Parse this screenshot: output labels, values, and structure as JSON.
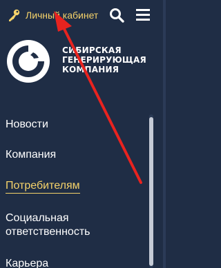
{
  "header": {
    "cabinet_label": "Личный кабинет",
    "key_icon": "key-icon",
    "search_icon": "search-icon",
    "menu_icon": "hamburger-menu-icon"
  },
  "logo": {
    "lines": [
      "СИБИРСКАЯ",
      "ГЕНЕРИРУЮЩАЯ",
      "КОМПАНИЯ"
    ]
  },
  "nav": {
    "items": [
      {
        "label": "Новости",
        "active": false
      },
      {
        "label": "Компания",
        "active": false
      },
      {
        "label": "Потребителям",
        "active": true
      },
      {
        "label": "Социальная",
        "active": false
      },
      {
        "label": "ответственность",
        "active": false
      },
      {
        "label": "Карьера",
        "active": false
      }
    ]
  },
  "colors": {
    "background": "#1f2d45",
    "accent": "#f6d36a",
    "arrow": "#e8231f",
    "text": "#ffffff"
  }
}
